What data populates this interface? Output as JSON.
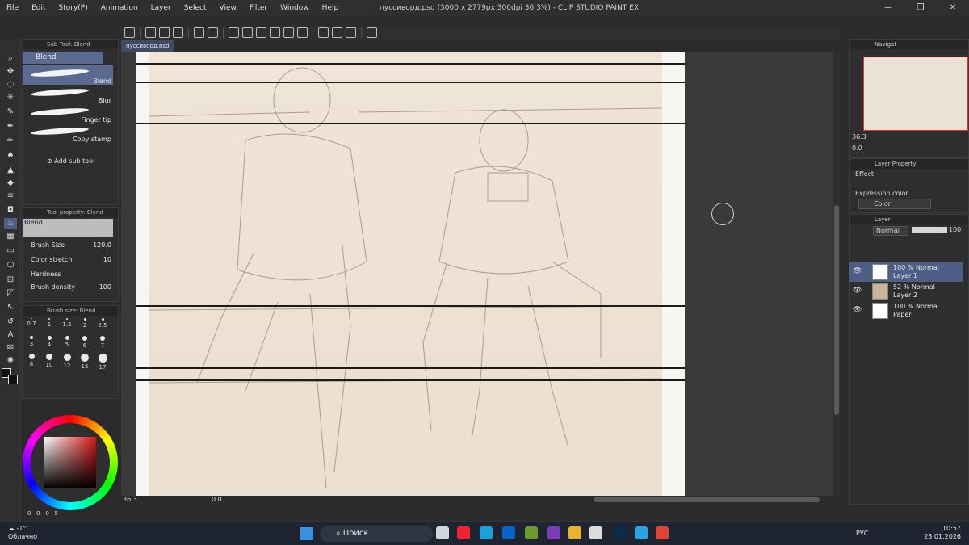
{
  "menu": [
    "File",
    "Edit",
    "Story(P)",
    "Animation",
    "Layer",
    "Select",
    "View",
    "Filter",
    "Window",
    "Help"
  ],
  "window_title": "пуссиворд.psd (3000 x 2779px 300dpi 36.3%)  - CLIP STUDIO PAINT EX",
  "document_tab": "пуссиворд.psd",
  "sub_tool_panel": {
    "header": "Sub Tool: Blend",
    "group": "Blend",
    "items": [
      "Blend",
      "Blur",
      "Finger tip",
      "Copy stamp"
    ],
    "add_label": "Add sub tool"
  },
  "tool_property": {
    "header": "Tool property: Blend",
    "tool_name": "Blend",
    "brush_size_label": "Brush Size",
    "brush_size": "120.0",
    "color_stretch_label": "Color stretch",
    "color_stretch": "10",
    "hardness_label": "Hardness",
    "brush_density_label": "Brush density",
    "brush_density": "100"
  },
  "brush_size_panel": {
    "header": "Brush size: Blend",
    "sizes": [
      "0.7",
      "1",
      "1.5",
      "2",
      "2.5",
      "3",
      "4",
      "5",
      "6",
      "7",
      "8",
      "10",
      "12",
      "15",
      "17"
    ]
  },
  "color_values": [
    "0",
    "0",
    "0",
    "5"
  ],
  "status": {
    "zoom": "36.3",
    "angle": "0.0"
  },
  "navigator": {
    "header": "Navigat",
    "zoom": "36.3",
    "angle": "0.0"
  },
  "layer_property": {
    "header": "Layer Property",
    "effect_label": "Effect",
    "expression_label": "Expression color",
    "expression_value": "Color"
  },
  "layer_panel": {
    "header": "Layer",
    "blend_mode": "Normal",
    "opacity": "100",
    "layers": [
      {
        "mode": "100 % Normal",
        "name": "Layer 1",
        "active": true,
        "thumb": "#ffffff"
      },
      {
        "mode": "52 % Normal",
        "name": "Layer 2",
        "active": false,
        "thumb": "#c9b39a"
      },
      {
        "mode": "100 % Normal",
        "name": "Paper",
        "active": false,
        "thumb": "#ffffff"
      }
    ]
  },
  "taskbar": {
    "temp": "-1°C",
    "condition": "Облачно",
    "search": "Поиск",
    "lang": "РУС",
    "time": "10:57",
    "date": "23.01.2026"
  }
}
